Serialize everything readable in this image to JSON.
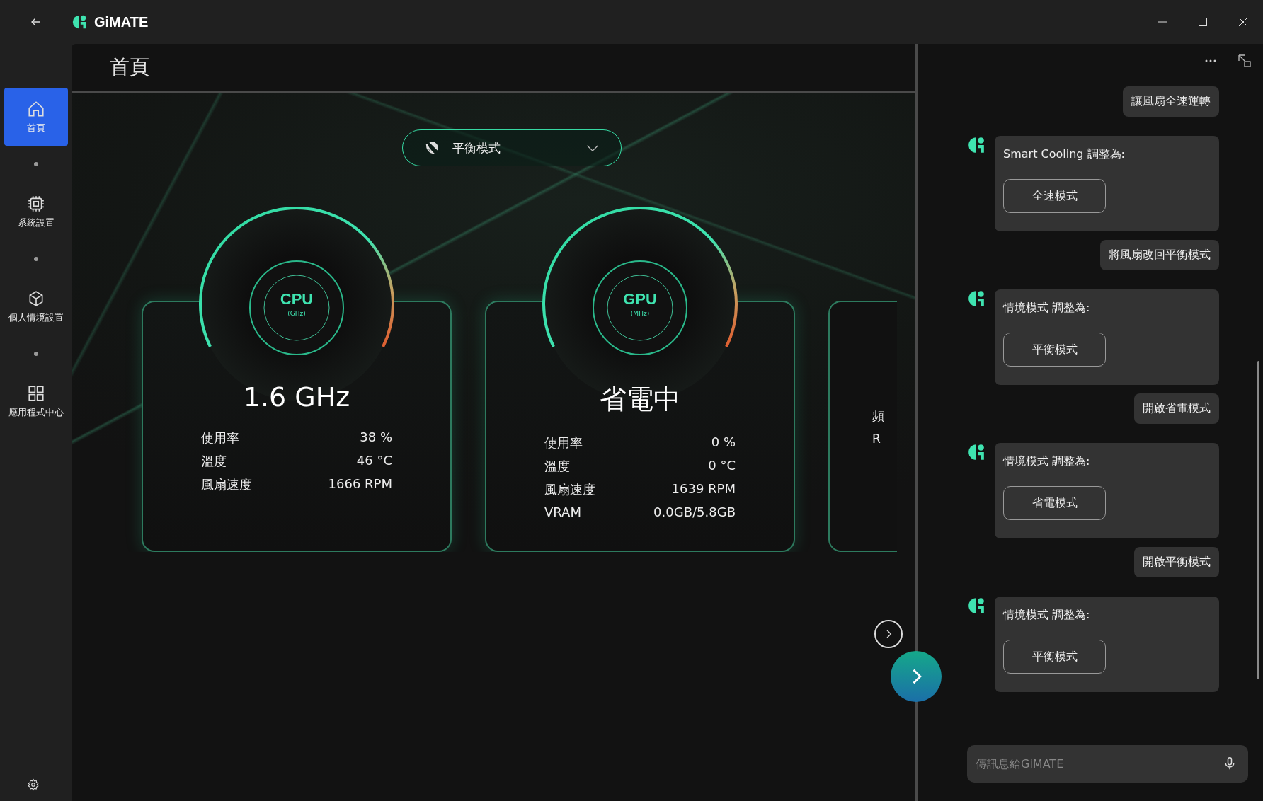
{
  "app": {
    "title": "GiMATE"
  },
  "sidebar": {
    "items": [
      {
        "kind": "home",
        "label": "首頁",
        "selected": true
      },
      {
        "kind": "chip",
        "label": "系統設置",
        "selected": false
      },
      {
        "kind": "cube",
        "label": "個人情境設置",
        "selected": false
      },
      {
        "kind": "grid",
        "label": "應用程式中心",
        "selected": false
      }
    ]
  },
  "page": {
    "title": "首頁"
  },
  "mode_dropdown": {
    "value": "平衡模式"
  },
  "cards": [
    {
      "kind": "full",
      "name": "CPU",
      "unit": "(GHz)",
      "value": "1.6 GHz",
      "stats": [
        {
          "label": "使用率",
          "value": "38 %"
        },
        {
          "label": "溫度",
          "value": "46 °C"
        },
        {
          "label": "風扇速度",
          "value": "1666 RPM"
        }
      ]
    },
    {
      "kind": "full",
      "name": "GPU",
      "unit": "(MHz)",
      "value": "省電中",
      "stats": [
        {
          "label": "使用率",
          "value": "0 %"
        },
        {
          "label": "溫度",
          "value": "0 °C"
        },
        {
          "label": "風扇速度",
          "value": "1639 RPM"
        },
        {
          "label": "VRAM",
          "value": "0.0GB/5.8GB"
        }
      ]
    },
    {
      "kind": "partial",
      "stats": [
        {
          "label": "頻"
        },
        {
          "label": "R"
        }
      ]
    }
  ],
  "chat": {
    "messages": [
      {
        "kind": "user",
        "text": "讓風扇全速運轉"
      },
      {
        "kind": "bot",
        "text": "Smart Cooling 調整為:",
        "action": "全速模式"
      },
      {
        "kind": "user",
        "text": "將風扇改回平衡模式"
      },
      {
        "kind": "bot",
        "text": "情境模式 調整為:",
        "action": "平衡模式"
      },
      {
        "kind": "user",
        "text": "開啟省電模式"
      },
      {
        "kind": "bot",
        "text": "情境模式 調整為:",
        "action": "省電模式"
      },
      {
        "kind": "user",
        "text": "開啟平衡模式"
      },
      {
        "kind": "bot",
        "text": "情境模式 調整為:",
        "action": "平衡模式"
      }
    ],
    "input": {
      "placeholder": "傳訊息給GiMATE"
    }
  }
}
